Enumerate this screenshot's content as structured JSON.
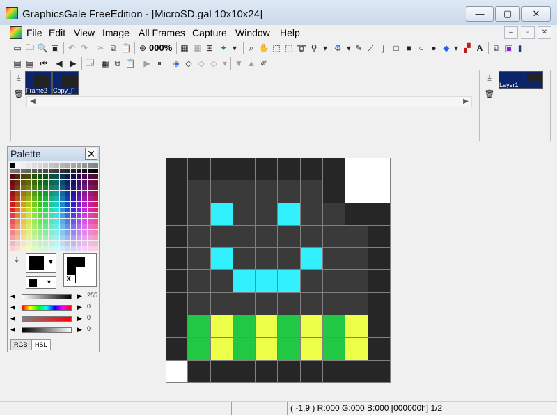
{
  "window": {
    "title": "GraphicsGale FreeEdition - [MicroSD.gal 10x10x24]",
    "minimize": "—",
    "maximize": "▢",
    "close": "✕"
  },
  "menu": {
    "items": [
      "File",
      "Edit",
      "View",
      "Image",
      "All Frames",
      "Capture",
      "Window",
      "Help"
    ],
    "mdi_min": "–",
    "mdi_restore": "▫",
    "mdi_close": "✕"
  },
  "toolbar": {
    "zoom": "000%"
  },
  "frames": {
    "items": [
      {
        "label": "Frame2",
        "selected": true
      },
      {
        "label": "Copy_F",
        "selected": true
      }
    ]
  },
  "layers": {
    "items": [
      {
        "label": "Layer1",
        "selected": true
      }
    ]
  },
  "palette": {
    "title": "Palette",
    "close": "✕",
    "sliders": [
      {
        "value": "255"
      },
      {
        "value": "0"
      },
      {
        "value": "0"
      },
      {
        "value": "0"
      }
    ],
    "tabs": [
      "RGB",
      "HSL"
    ],
    "active_tab": "HSL",
    "box_label": "X"
  },
  "canvas": {
    "pixels": [
      [
        "#262626",
        "#262626",
        "#262626",
        "#262626",
        "#262626",
        "#262626",
        "#262626",
        "#262626",
        "#ffffff",
        "#ffffff"
      ],
      [
        "#262626",
        "#3a3a3a",
        "#3a3a3a",
        "#3a3a3a",
        "#3a3a3a",
        "#3a3a3a",
        "#3a3a3a",
        "#262626",
        "#ffffff",
        "#ffffff"
      ],
      [
        "#262626",
        "#3a3a3a",
        "#33f0ff",
        "#3a3a3a",
        "#3a3a3a",
        "#33f0ff",
        "#3a3a3a",
        "#3a3a3a",
        "#262626",
        "#262626"
      ],
      [
        "#262626",
        "#3a3a3a",
        "#3a3a3a",
        "#3a3a3a",
        "#3a3a3a",
        "#3a3a3a",
        "#3a3a3a",
        "#3a3a3a",
        "#3a3a3a",
        "#262626"
      ],
      [
        "#262626",
        "#3a3a3a",
        "#33f0ff",
        "#3a3a3a",
        "#3a3a3a",
        "#3a3a3a",
        "#33f0ff",
        "#3a3a3a",
        "#3a3a3a",
        "#262626"
      ],
      [
        "#262626",
        "#3a3a3a",
        "#3a3a3a",
        "#33f0ff",
        "#33f0ff",
        "#33f0ff",
        "#3a3a3a",
        "#3a3a3a",
        "#3a3a3a",
        "#262626"
      ],
      [
        "#262626",
        "#3a3a3a",
        "#3a3a3a",
        "#3a3a3a",
        "#3a3a3a",
        "#3a3a3a",
        "#3a3a3a",
        "#3a3a3a",
        "#3a3a3a",
        "#262626"
      ],
      [
        "#262626",
        "#20c844",
        "#eeff4a",
        "#20c844",
        "#eeff4a",
        "#20c844",
        "#eeff4a",
        "#20c844",
        "#eeff4a",
        "#262626"
      ],
      [
        "#262626",
        "#20c844",
        "#eeff4a",
        "#20c844",
        "#eeff4a",
        "#20c844",
        "#eeff4a",
        "#20c844",
        "#eeff4a",
        "#262626"
      ],
      [
        "#ffffff",
        "#262626",
        "#262626",
        "#262626",
        "#262626",
        "#262626",
        "#262626",
        "#262626",
        "#262626",
        "#262626"
      ]
    ]
  },
  "status": {
    "info": "( -1,9 ) R:000 G:000 B:000  [000000h]  1/2"
  }
}
